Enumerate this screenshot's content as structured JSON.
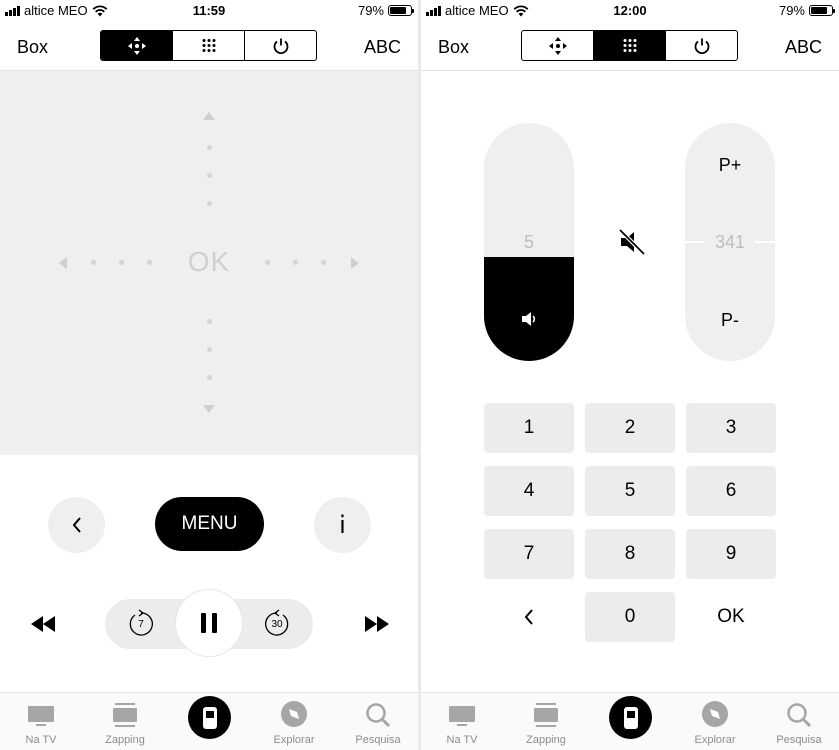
{
  "left": {
    "status": {
      "carrier": "altice MEO",
      "time": "11:59",
      "battery": "79%"
    },
    "nav": {
      "left": "Box",
      "right": "ABC"
    },
    "touchpad": {
      "center": "OK"
    },
    "controls": {
      "menu": "MENU",
      "info": "i",
      "rewind_seconds": "7",
      "forward_seconds": "30"
    },
    "tabs": [
      {
        "label": "Na TV"
      },
      {
        "label": "Zapping"
      },
      {
        "label": "Explorar"
      },
      {
        "label": "Pesquisa"
      }
    ]
  },
  "right": {
    "status": {
      "carrier": "altice MEO",
      "time": "12:00",
      "battery": "79%"
    },
    "nav": {
      "left": "Box",
      "right": "ABC"
    },
    "volume": {
      "value": "5"
    },
    "channel": {
      "up": "P+",
      "value": "341",
      "down": "P-"
    },
    "keypad": [
      "1",
      "2",
      "3",
      "4",
      "5",
      "6",
      "7",
      "8",
      "9",
      "0",
      "OK"
    ],
    "tabs": [
      {
        "label": "Na TV"
      },
      {
        "label": "Zapping"
      },
      {
        "label": "Explorar"
      },
      {
        "label": "Pesquisa"
      }
    ]
  },
  "battery_level": 0.79,
  "colors": {
    "accent": "#000000",
    "panel": "#efefef",
    "muted_text": "#8c8c8c"
  }
}
